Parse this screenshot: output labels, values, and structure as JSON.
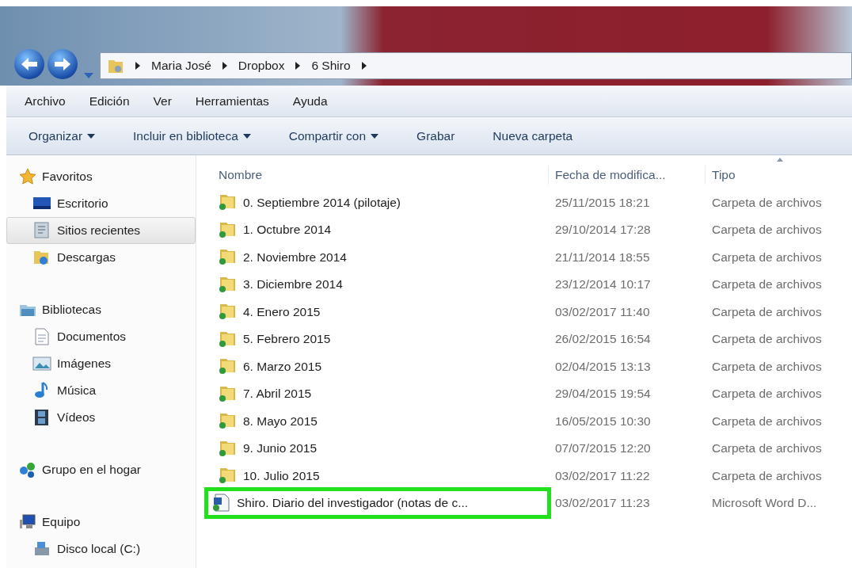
{
  "breadcrumb": [
    "Maria José",
    "Dropbox",
    "6 Shiro"
  ],
  "menu": [
    "Archivo",
    "Edición",
    "Ver",
    "Herramientas",
    "Ayuda"
  ],
  "toolbar": [
    {
      "label": "Organizar",
      "dropdown": true
    },
    {
      "label": "Incluir en biblioteca",
      "dropdown": true
    },
    {
      "label": "Compartir con",
      "dropdown": true
    },
    {
      "label": "Grabar",
      "dropdown": false
    },
    {
      "label": "Nueva carpeta",
      "dropdown": false
    }
  ],
  "sidebar": [
    {
      "label": "Favoritos",
      "children": [
        {
          "label": "Escritorio",
          "selected": false
        },
        {
          "label": "Sitios recientes",
          "selected": true
        },
        {
          "label": "Descargas",
          "selected": false
        }
      ]
    },
    {
      "label": "Bibliotecas",
      "children": [
        {
          "label": "Documentos",
          "selected": false
        },
        {
          "label": "Imágenes",
          "selected": false
        },
        {
          "label": "Música",
          "selected": false
        },
        {
          "label": "Vídeos",
          "selected": false
        }
      ]
    },
    {
      "label": "Grupo en el hogar"
    },
    {
      "label": "Equipo",
      "children": [
        {
          "label": "Disco local (C:)",
          "selected": false
        }
      ]
    }
  ],
  "table": {
    "columns": [
      "Nombre",
      "Fecha de modifica...",
      "Tipo"
    ],
    "rows": [
      {
        "kind": "folder",
        "name": "0. Septiembre 2014 (pilotaje)",
        "date": "25/11/2015 18:21",
        "type": "Carpeta de archivos",
        "highlighted": false
      },
      {
        "kind": "folder",
        "name": "1. Octubre 2014",
        "date": "29/10/2014 17:28",
        "type": "Carpeta de archivos",
        "highlighted": false
      },
      {
        "kind": "folder",
        "name": "2. Noviembre 2014",
        "date": "21/11/2014 18:55",
        "type": "Carpeta de archivos",
        "highlighted": false
      },
      {
        "kind": "folder",
        "name": "3. Diciembre 2014",
        "date": "23/12/2014 10:17",
        "type": "Carpeta de archivos",
        "highlighted": false
      },
      {
        "kind": "folder",
        "name": "4. Enero 2015",
        "date": "03/02/2017 11:40",
        "type": "Carpeta de archivos",
        "highlighted": false
      },
      {
        "kind": "folder",
        "name": "5. Febrero 2015",
        "date": "26/02/2015 16:54",
        "type": "Carpeta de archivos",
        "highlighted": false
      },
      {
        "kind": "folder",
        "name": "6. Marzo 2015",
        "date": "02/04/2015 13:13",
        "type": "Carpeta de archivos",
        "highlighted": false
      },
      {
        "kind": "folder",
        "name": "7. Abril 2015",
        "date": "29/04/2015 19:54",
        "type": "Carpeta de archivos",
        "highlighted": false
      },
      {
        "kind": "folder",
        "name": "8. Mayo 2015",
        "date": "16/05/2015 10:30",
        "type": "Carpeta de archivos",
        "highlighted": false
      },
      {
        "kind": "folder",
        "name": "9. Junio 2015",
        "date": "07/07/2015 12:20",
        "type": "Carpeta de archivos",
        "highlighted": false
      },
      {
        "kind": "folder",
        "name": "10. Julio 2015",
        "date": "03/02/2017 11:22",
        "type": "Carpeta de archivos",
        "highlighted": false
      },
      {
        "kind": "document",
        "name": "Shiro. Diario del investigador (notas de c...",
        "date": "03/02/2017 11:23",
        "type": "Microsoft Word D...",
        "highlighted": true
      }
    ]
  }
}
